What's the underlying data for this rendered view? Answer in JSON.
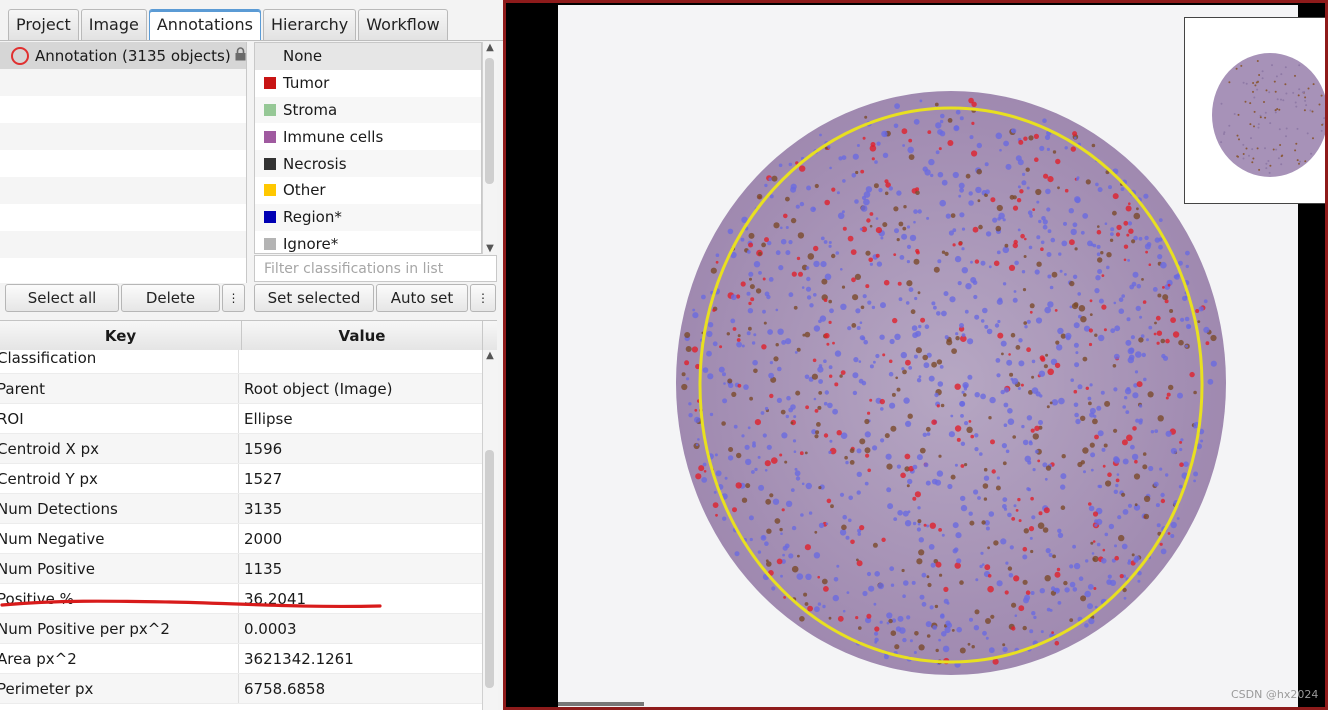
{
  "tabs": [
    "Project",
    "Image",
    "Annotations",
    "Hierarchy",
    "Workflow"
  ],
  "annotation_list": {
    "items": [
      "Annotation (3135 objects)"
    ]
  },
  "classifications": [
    {
      "label": "None",
      "color": ""
    },
    {
      "label": "Tumor",
      "color": "#c81414"
    },
    {
      "label": "Stroma",
      "color": "#96c896"
    },
    {
      "label": "Immune cells",
      "color": "#a05aa0"
    },
    {
      "label": "Necrosis",
      "color": "#323232"
    },
    {
      "label": "Other",
      "color": "#ffc800"
    },
    {
      "label": "Region*",
      "color": "#0000b4"
    },
    {
      "label": "Ignore*",
      "color": "#b4b4b4"
    }
  ],
  "filter": {
    "placeholder": "Filter classifications in list"
  },
  "buttons": {
    "select_all": "Select all",
    "delete": "Delete",
    "more": "⋮",
    "set_selected": "Set selected",
    "auto_set": "Auto set"
  },
  "properties": {
    "key_header": "Key",
    "value_header": "Value",
    "rows": [
      {
        "key": "Classification",
        "value": ""
      },
      {
        "key": "Parent",
        "value": "Root object (Image)"
      },
      {
        "key": "ROI",
        "value": "Ellipse"
      },
      {
        "key": "Centroid X px",
        "value": "1596"
      },
      {
        "key": "Centroid Y px",
        "value": "1527"
      },
      {
        "key": "Num Detections",
        "value": "3135"
      },
      {
        "key": "Num Negative",
        "value": "2000"
      },
      {
        "key": "Num Positive",
        "value": "1135"
      },
      {
        "key": "Positive %",
        "value": "36.2041"
      },
      {
        "key": "Num Positive per px^2",
        "value": "0.0003"
      },
      {
        "key": "Area px^2",
        "value": "3621342.1261"
      },
      {
        "key": "Perimeter px",
        "value": "6758.6858"
      }
    ]
  },
  "watermark": "CSDN @hx2024",
  "colors": {
    "annotation_outline": "#e8e020",
    "positive_cells": "#e0202c",
    "negative_cells": "#6a6ae0",
    "highlight_mark": "#d81b1b"
  }
}
